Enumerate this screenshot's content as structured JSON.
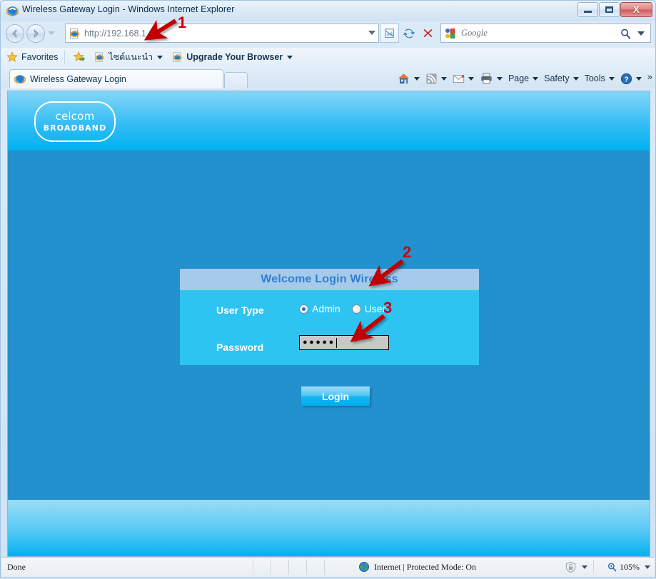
{
  "window": {
    "title": "Wireless Gateway Login - Windows Internet Explorer",
    "icon": "internet-explorer-icon",
    "minimize_label": "Minimize",
    "maximize_label": "Maximize",
    "close_label": "Close",
    "close_glyph": "X"
  },
  "nav": {
    "back_label": "Back",
    "forward_label": "Forward",
    "back_glyph": "◀",
    "forward_glyph": "▶",
    "address_value": "http://192.168.1.1/",
    "address_placeholder": "http://192.168.1.1/",
    "compatibility_label": "Compatibility View",
    "refresh_label": "Refresh",
    "stop_label": "Stop",
    "search_placeholder": "Google",
    "search_value": ""
  },
  "favorites": {
    "favorites_label": "Favorites",
    "suggested_sites_label": "ไซต์แนะนำ",
    "upgrade_label": "Upgrade Your Browser"
  },
  "tabs": {
    "active_tab_label": "Wireless Gateway Login",
    "new_tab_label": "New Tab"
  },
  "commandbar": {
    "home_label": "Home",
    "feeds_label": "Feeds",
    "mail_label": "Read Mail",
    "print_label": "Print",
    "page_label": "Page",
    "safety_label": "Safety",
    "tools_label": "Tools",
    "help_label": "Help",
    "overflow_glyph": "»"
  },
  "page": {
    "logo_main": "celcom",
    "logo_sub": "BROADBAND",
    "header_gradient_top": "#84d6f8",
    "header_gradient_bottom": "#00b1f0",
    "body_color": "#2391ce",
    "footer_gradient_top": "#9adcf7",
    "footer_gradient_bottom": "#00b1f0",
    "form": {
      "title": "Welcome Login Wireless",
      "title_color": "#2f80d2",
      "title_bar_color": "#a6caea",
      "body_color": "#2ec4f1",
      "user_type_label": "User Type",
      "radio_options": [
        {
          "label": "Admin",
          "selected": true
        },
        {
          "label": "User",
          "selected": false
        }
      ],
      "password_label": "Password",
      "password_value": "●●●●●",
      "password_placeholder": "",
      "login_button_label": "Login"
    }
  },
  "annotations": [
    {
      "number": "1",
      "target": "address-bar"
    },
    {
      "number": "2",
      "target": "password-field"
    },
    {
      "number": "3",
      "target": "login-button"
    }
  ],
  "status": {
    "message": "Done",
    "zone": "Internet | Protected Mode: On",
    "zone_icon": "internet-zone-icon",
    "privacy_icon": "privacy-report-icon",
    "zoom_level": "105%",
    "zoom_icon": "zoom-icon"
  }
}
